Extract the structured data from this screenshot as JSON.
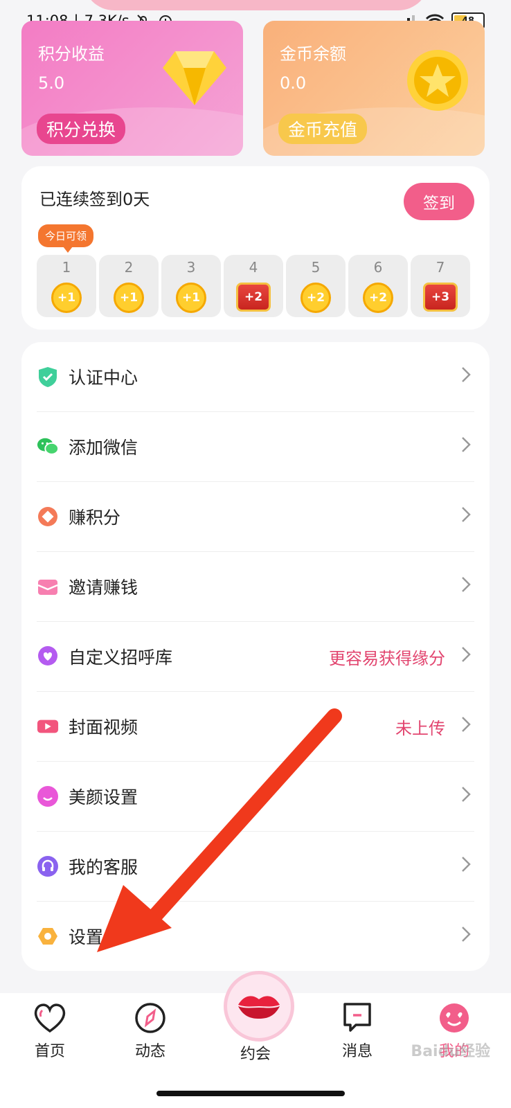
{
  "status": {
    "time": "11:08",
    "speed": "7.3K/s",
    "battery": "48",
    "battery_level": 0.48
  },
  "cards": {
    "points": {
      "title": "积分收益",
      "value": "5.0",
      "button": "积分兑换"
    },
    "coins": {
      "title": "金币余额",
      "value": "0.0",
      "button": "金币充值"
    }
  },
  "checkin": {
    "title": "已连续签到0天",
    "button": "签到",
    "today_badge": "今日可领",
    "days": [
      {
        "num": "1",
        "reward": "+1",
        "kind": "coin"
      },
      {
        "num": "2",
        "reward": "+1",
        "kind": "coin"
      },
      {
        "num": "3",
        "reward": "+1",
        "kind": "coin"
      },
      {
        "num": "4",
        "reward": "+2",
        "kind": "chest"
      },
      {
        "num": "5",
        "reward": "+2",
        "kind": "coin"
      },
      {
        "num": "6",
        "reward": "+2",
        "kind": "coin"
      },
      {
        "num": "7",
        "reward": "+3",
        "kind": "chest"
      }
    ]
  },
  "menu": [
    {
      "label": "认证中心",
      "icon": "shield-check-icon",
      "extra": ""
    },
    {
      "label": "添加微信",
      "icon": "wechat-icon",
      "extra": ""
    },
    {
      "label": "赚积分",
      "icon": "diamond-icon",
      "extra": ""
    },
    {
      "label": "邀请赚钱",
      "icon": "envelope-icon",
      "extra": ""
    },
    {
      "label": "自定义招呼库",
      "icon": "heart-chat-icon",
      "extra": "更容易获得缘分"
    },
    {
      "label": "封面视频",
      "icon": "video-icon",
      "extra": "未上传"
    },
    {
      "label": "美颜设置",
      "icon": "smile-icon",
      "extra": ""
    },
    {
      "label": "我的客服",
      "icon": "headset-icon",
      "extra": ""
    },
    {
      "label": "设置",
      "icon": "hexagon-gear-icon",
      "extra": ""
    }
  ],
  "tabs": [
    {
      "label": "首页",
      "icon": "heart-outline-icon"
    },
    {
      "label": "动态",
      "icon": "compass-icon"
    },
    {
      "label": "约会",
      "icon": "lips-icon"
    },
    {
      "label": "消息",
      "icon": "message-icon"
    },
    {
      "label": "我的",
      "icon": "love-face-icon"
    }
  ],
  "watermark": "Baidu经验",
  "colors": {
    "accent": "#f25e8a",
    "highlight_text": "#e2456f",
    "annotation_arrow": "#f0391c"
  }
}
